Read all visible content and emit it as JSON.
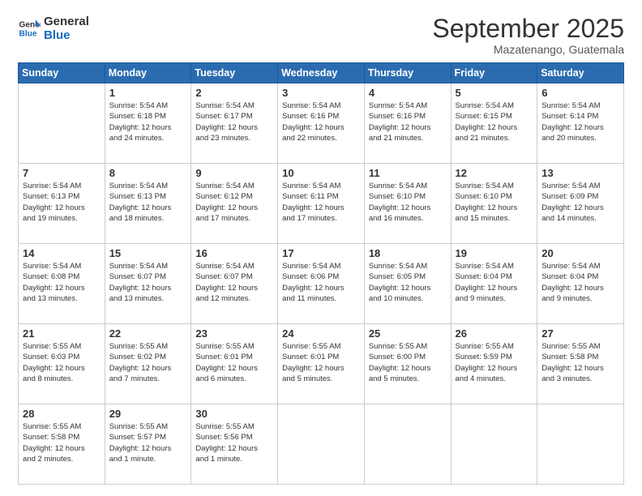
{
  "logo": {
    "line1": "General",
    "line2": "Blue"
  },
  "title": "September 2025",
  "location": "Mazatenango, Guatemala",
  "days_header": [
    "Sunday",
    "Monday",
    "Tuesday",
    "Wednesday",
    "Thursday",
    "Friday",
    "Saturday"
  ],
  "weeks": [
    [
      {
        "day": "",
        "info": ""
      },
      {
        "day": "1",
        "info": "Sunrise: 5:54 AM\nSunset: 6:18 PM\nDaylight: 12 hours\nand 24 minutes."
      },
      {
        "day": "2",
        "info": "Sunrise: 5:54 AM\nSunset: 6:17 PM\nDaylight: 12 hours\nand 23 minutes."
      },
      {
        "day": "3",
        "info": "Sunrise: 5:54 AM\nSunset: 6:16 PM\nDaylight: 12 hours\nand 22 minutes."
      },
      {
        "day": "4",
        "info": "Sunrise: 5:54 AM\nSunset: 6:16 PM\nDaylight: 12 hours\nand 21 minutes."
      },
      {
        "day": "5",
        "info": "Sunrise: 5:54 AM\nSunset: 6:15 PM\nDaylight: 12 hours\nand 21 minutes."
      },
      {
        "day": "6",
        "info": "Sunrise: 5:54 AM\nSunset: 6:14 PM\nDaylight: 12 hours\nand 20 minutes."
      }
    ],
    [
      {
        "day": "7",
        "info": "Sunrise: 5:54 AM\nSunset: 6:13 PM\nDaylight: 12 hours\nand 19 minutes."
      },
      {
        "day": "8",
        "info": "Sunrise: 5:54 AM\nSunset: 6:13 PM\nDaylight: 12 hours\nand 18 minutes."
      },
      {
        "day": "9",
        "info": "Sunrise: 5:54 AM\nSunset: 6:12 PM\nDaylight: 12 hours\nand 17 minutes."
      },
      {
        "day": "10",
        "info": "Sunrise: 5:54 AM\nSunset: 6:11 PM\nDaylight: 12 hours\nand 17 minutes."
      },
      {
        "day": "11",
        "info": "Sunrise: 5:54 AM\nSunset: 6:10 PM\nDaylight: 12 hours\nand 16 minutes."
      },
      {
        "day": "12",
        "info": "Sunrise: 5:54 AM\nSunset: 6:10 PM\nDaylight: 12 hours\nand 15 minutes."
      },
      {
        "day": "13",
        "info": "Sunrise: 5:54 AM\nSunset: 6:09 PM\nDaylight: 12 hours\nand 14 minutes."
      }
    ],
    [
      {
        "day": "14",
        "info": "Sunrise: 5:54 AM\nSunset: 6:08 PM\nDaylight: 12 hours\nand 13 minutes."
      },
      {
        "day": "15",
        "info": "Sunrise: 5:54 AM\nSunset: 6:07 PM\nDaylight: 12 hours\nand 13 minutes."
      },
      {
        "day": "16",
        "info": "Sunrise: 5:54 AM\nSunset: 6:07 PM\nDaylight: 12 hours\nand 12 minutes."
      },
      {
        "day": "17",
        "info": "Sunrise: 5:54 AM\nSunset: 6:06 PM\nDaylight: 12 hours\nand 11 minutes."
      },
      {
        "day": "18",
        "info": "Sunrise: 5:54 AM\nSunset: 6:05 PM\nDaylight: 12 hours\nand 10 minutes."
      },
      {
        "day": "19",
        "info": "Sunrise: 5:54 AM\nSunset: 6:04 PM\nDaylight: 12 hours\nand 9 minutes."
      },
      {
        "day": "20",
        "info": "Sunrise: 5:54 AM\nSunset: 6:04 PM\nDaylight: 12 hours\nand 9 minutes."
      }
    ],
    [
      {
        "day": "21",
        "info": "Sunrise: 5:55 AM\nSunset: 6:03 PM\nDaylight: 12 hours\nand 8 minutes."
      },
      {
        "day": "22",
        "info": "Sunrise: 5:55 AM\nSunset: 6:02 PM\nDaylight: 12 hours\nand 7 minutes."
      },
      {
        "day": "23",
        "info": "Sunrise: 5:55 AM\nSunset: 6:01 PM\nDaylight: 12 hours\nand 6 minutes."
      },
      {
        "day": "24",
        "info": "Sunrise: 5:55 AM\nSunset: 6:01 PM\nDaylight: 12 hours\nand 5 minutes."
      },
      {
        "day": "25",
        "info": "Sunrise: 5:55 AM\nSunset: 6:00 PM\nDaylight: 12 hours\nand 5 minutes."
      },
      {
        "day": "26",
        "info": "Sunrise: 5:55 AM\nSunset: 5:59 PM\nDaylight: 12 hours\nand 4 minutes."
      },
      {
        "day": "27",
        "info": "Sunrise: 5:55 AM\nSunset: 5:58 PM\nDaylight: 12 hours\nand 3 minutes."
      }
    ],
    [
      {
        "day": "28",
        "info": "Sunrise: 5:55 AM\nSunset: 5:58 PM\nDaylight: 12 hours\nand 2 minutes."
      },
      {
        "day": "29",
        "info": "Sunrise: 5:55 AM\nSunset: 5:57 PM\nDaylight: 12 hours\nand 1 minute."
      },
      {
        "day": "30",
        "info": "Sunrise: 5:55 AM\nSunset: 5:56 PM\nDaylight: 12 hours\nand 1 minute."
      },
      {
        "day": "",
        "info": ""
      },
      {
        "day": "",
        "info": ""
      },
      {
        "day": "",
        "info": ""
      },
      {
        "day": "",
        "info": ""
      }
    ]
  ]
}
